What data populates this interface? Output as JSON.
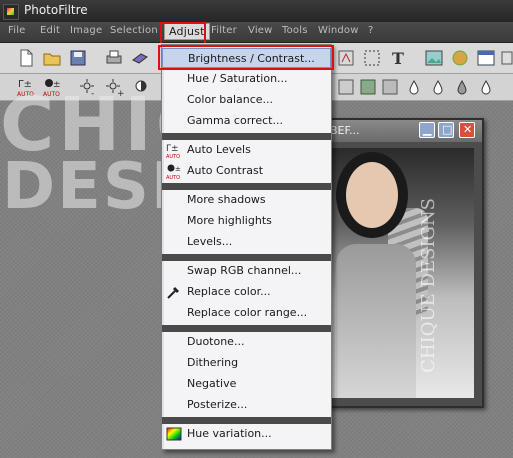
{
  "window": {
    "title": "PhotoFiltre"
  },
  "menubar": {
    "items": [
      {
        "label": "File"
      },
      {
        "label": "Edit"
      },
      {
        "label": "Image"
      },
      {
        "label": "Selection"
      },
      {
        "label": "Adjust"
      },
      {
        "label": "Filter"
      },
      {
        "label": "View"
      },
      {
        "label": "Tools"
      },
      {
        "label": "Window"
      },
      {
        "label": "?"
      }
    ]
  },
  "watermark": {
    "line1": "CHIQUE",
    "line2": "DESIGNS"
  },
  "document": {
    "title": "BEF...",
    "photo_watermark": "CHIQUE DESIGNS"
  },
  "adjust_menu": {
    "groups": [
      [
        {
          "label": "Brightness / Contrast...",
          "icon": "brightness-contrast-icon"
        },
        {
          "label": "Hue / Saturation...",
          "icon": ""
        },
        {
          "label": "Color balance...",
          "icon": ""
        },
        {
          "label": "Gamma correct...",
          "icon": ""
        }
      ],
      [
        {
          "label": "Auto Levels",
          "icon": "auto-levels-icon"
        },
        {
          "label": "Auto Contrast",
          "icon": "auto-contrast-icon"
        }
      ],
      [
        {
          "label": "More shadows",
          "icon": ""
        },
        {
          "label": "More highlights",
          "icon": ""
        },
        {
          "label": "Levels...",
          "icon": ""
        }
      ],
      [
        {
          "label": "Swap RGB channel...",
          "icon": ""
        },
        {
          "label": "Replace color...",
          "icon": "eyedropper-icon"
        },
        {
          "label": "Replace color range...",
          "icon": ""
        }
      ],
      [
        {
          "label": "Duotone...",
          "icon": ""
        },
        {
          "label": "Dithering",
          "icon": ""
        },
        {
          "label": "Negative",
          "icon": ""
        },
        {
          "label": "Posterize...",
          "icon": ""
        }
      ],
      [
        {
          "label": "Hue variation...",
          "icon": "hue-variation-icon"
        }
      ]
    ]
  },
  "colors": {
    "highlight_border": "#e01010",
    "selection": "#c6d4ec",
    "separator": "#4a4a4a"
  }
}
